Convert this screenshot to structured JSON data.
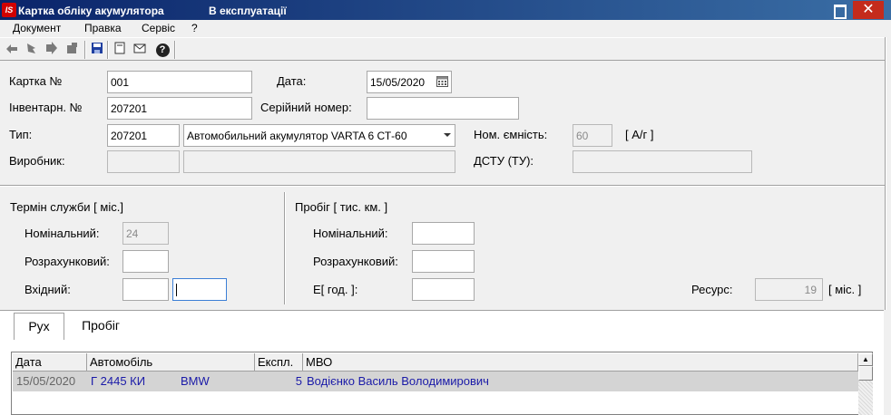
{
  "window": {
    "logo": "IS",
    "title": "Картка обліку акумулятора",
    "status": "В експлуатації",
    "close_glyph": "✕"
  },
  "menu": [
    "Документ",
    "Правка",
    "Сервіс",
    "?"
  ],
  "toolbar": {
    "icons": [
      "nav-first-icon",
      "nav-prev-icon",
      "nav-next-icon",
      "nav-last-icon",
      "save-icon",
      "document-icon",
      "mail-icon",
      "help-icon"
    ],
    "help_glyph": "?"
  },
  "form": {
    "card_no_label": "Картка №",
    "card_no": "001",
    "date_label": "Дата:",
    "date": "15/05/2020",
    "inv_no_label": "Інвентарн. №",
    "inv_no": "207201",
    "serial_label": "Серійний номер:",
    "serial": "",
    "type_label": "Тип:",
    "type_code": "207201",
    "type_name": "Автомобильний акумулятор VARTA 6 СТ-60",
    "capacity_label": "Ном. ємність:",
    "capacity": "60",
    "capacity_unit": "[ А/г ]",
    "maker_label": "Виробник:",
    "maker_code": "",
    "maker_name": "",
    "dstu_label": "ДСТУ (ТУ):",
    "dstu": ""
  },
  "service_life": {
    "title": "Термін служби [ міс.]",
    "nominal_label": "Номінальний:",
    "nominal": "24",
    "calc_label": "Розрахунковий:",
    "calc": "",
    "input_label": "Вхідний:",
    "input1": "",
    "input2": ""
  },
  "mileage": {
    "title": "Пробіг [ тис. км. ]",
    "nominal_label": "Номінальний:",
    "nominal": "",
    "calc_label": "Розрахунковий:",
    "calc": "",
    "input_label": "Е[ год. ]:",
    "input": ""
  },
  "resource": {
    "label": "Ресурс:",
    "value": "19",
    "unit": "[ міс. ]"
  },
  "tabs": [
    "Рух",
    "Пробіг"
  ],
  "grid": {
    "columns": [
      "Дата",
      "Автомобіль",
      "Експл.",
      "МВО"
    ],
    "rows": [
      {
        "date": "15/05/2020",
        "car_no": "Г 2445 КИ",
        "car_brand": "BMW",
        "expl": "5",
        "mvo": "Водієнко Василь Володимирович"
      }
    ]
  }
}
